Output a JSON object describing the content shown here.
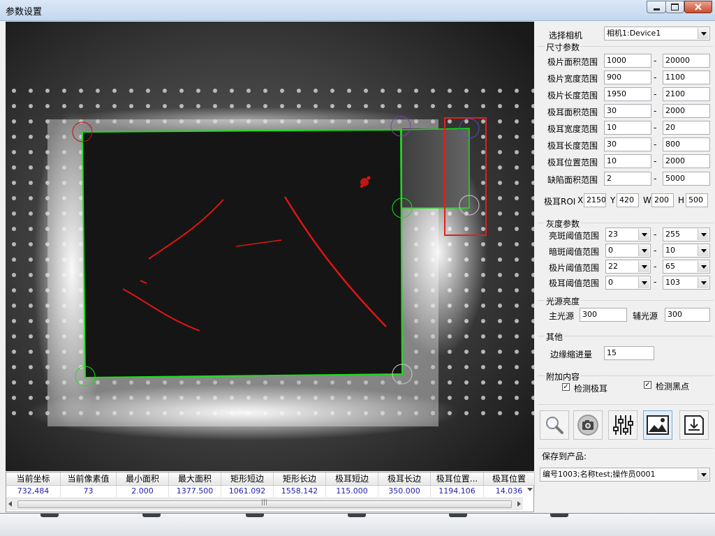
{
  "window": {
    "title": "参数设置"
  },
  "camera": {
    "label": "选择相机",
    "selected": "相机1:Device1"
  },
  "size_group": {
    "title": "尺寸参数",
    "rows": [
      {
        "label": "极片面积范围",
        "min": "1000",
        "max": "20000"
      },
      {
        "label": "极片宽度范围",
        "min": "900",
        "max": "1100"
      },
      {
        "label": "极片长度范围",
        "min": "1950",
        "max": "2100"
      },
      {
        "label": "极耳面积范围",
        "min": "30",
        "max": "2000"
      },
      {
        "label": "极耳宽度范围",
        "min": "10",
        "max": "20"
      },
      {
        "label": "极耳长度范围",
        "min": "30",
        "max": "800"
      },
      {
        "label": "极耳位置范围",
        "min": "10",
        "max": "2000"
      },
      {
        "label": "缺陷面积范围",
        "min": "2",
        "max": "5000"
      }
    ],
    "dash": "-",
    "roi": {
      "label": "极耳ROI",
      "x_label": "X",
      "x": "2150",
      "y_label": "Y",
      "y": "420",
      "w_label": "W",
      "w": "200",
      "h_label": "H",
      "h": "500"
    }
  },
  "gray_group": {
    "title": "灰度参数",
    "rows": [
      {
        "label": "亮斑阈值范围",
        "min": "23",
        "max": "255"
      },
      {
        "label": "暗斑阈值范围",
        "min": "0",
        "max": "10"
      },
      {
        "label": "极片阈值范围",
        "min": "22",
        "max": "65"
      },
      {
        "label": "极耳阈值范围",
        "min": "0",
        "max": "103"
      }
    ]
  },
  "light_group": {
    "title": "光源亮度",
    "main_label": "主光源",
    "main_value": "300",
    "aux_label": "辅光源",
    "aux_value": "300"
  },
  "other_group": {
    "title": "其他",
    "shrink_label": "边缘缩进量",
    "shrink_value": "15"
  },
  "extra_group": {
    "title": "附加内容",
    "tab_check": "检测极耳",
    "tab_checked": true,
    "dot_check": "检测黑点",
    "dot_checked": true
  },
  "toolbar": {
    "icons": [
      "magnifier-icon",
      "camera-icon",
      "sliders-icon",
      "image-icon",
      "save-icon"
    ]
  },
  "save": {
    "label": "保存到产品:",
    "selected": "编号1003;名称test;操作员0001"
  },
  "results": {
    "headers": [
      "当前坐标",
      "当前像素值",
      "最小面积",
      "最大面积",
      "矩形短边",
      "矩形长边",
      "极耳短边",
      "极耳长边",
      "极耳位置...",
      "极耳位置"
    ],
    "values": [
      "732,484",
      "73",
      "2.000",
      "1377.500",
      "1061.092",
      "1558.142",
      "115.000",
      "350.000",
      "1194.106",
      "14.036"
    ],
    "scroll_marker": "|||"
  },
  "colors": {
    "detect_outline": "#19e019",
    "defect": "#e01515",
    "roi_box": "#e02020"
  }
}
